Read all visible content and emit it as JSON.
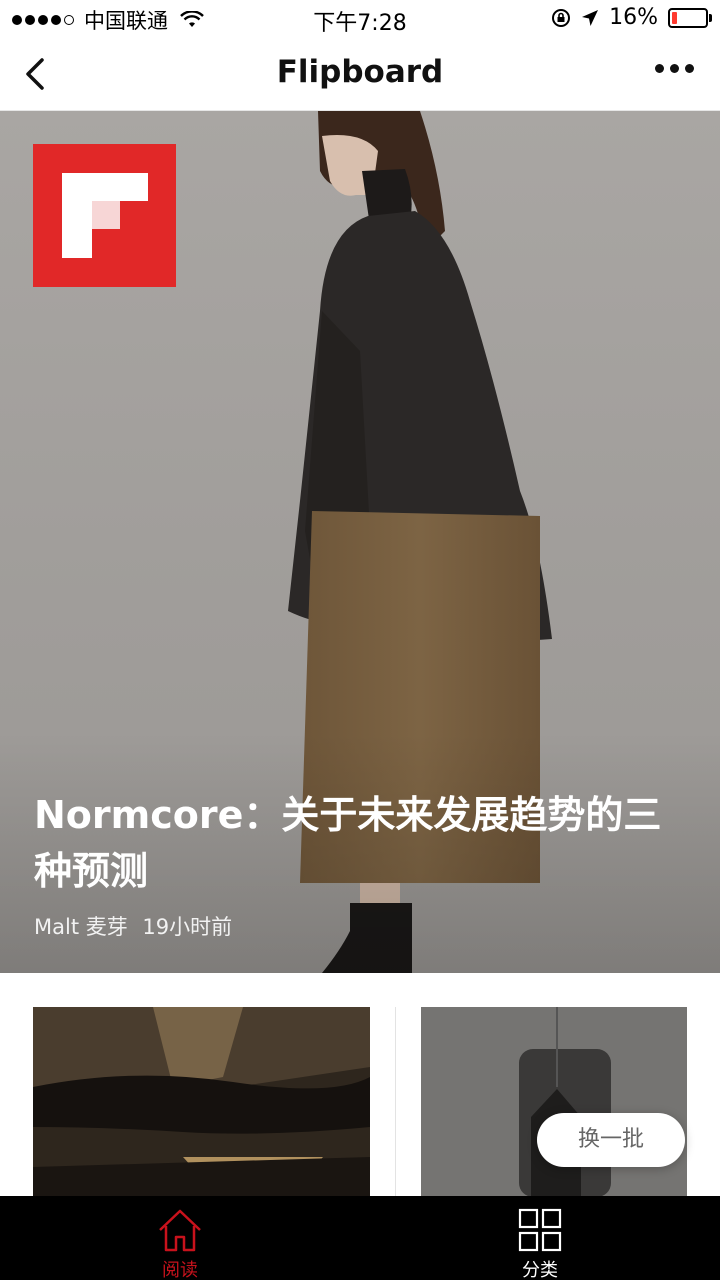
{
  "status_bar": {
    "carrier": "中国联通",
    "time": "下午7:28",
    "battery": "16%",
    "battery_level": 0.16
  },
  "nav": {
    "title": "Flipboard"
  },
  "hero": {
    "title": "Normcore：关于未来发展趋势的三种预测",
    "source": "Malt 麦芽",
    "time_ago": "19小时前"
  },
  "refresh_label": "换一批",
  "tabs": [
    {
      "label": "阅读",
      "icon": "home-icon",
      "active": true
    },
    {
      "label": "分类",
      "icon": "grid-icon",
      "active": false
    }
  ],
  "colors": {
    "brand_red": "#e12828",
    "active_tab": "#c8121c",
    "inactive_tab": "#ffffff"
  }
}
